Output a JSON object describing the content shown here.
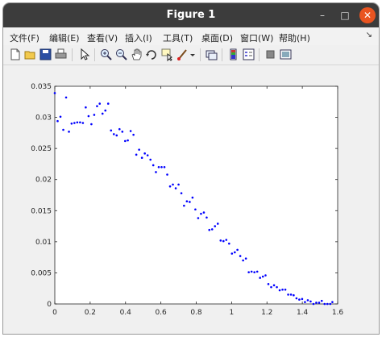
{
  "window": {
    "title": "Figure 1"
  },
  "menu": [
    "文件(F)",
    "编辑(E)",
    "查看(V)",
    "插入(I)",
    "工具(T)",
    "桌面(D)",
    "窗口(W)",
    "帮助(H)"
  ],
  "toolbar_icons": [
    "new-figure-icon",
    "open-file-icon",
    "save-icon",
    "print-icon",
    "pointer-icon",
    "zoom-in-icon",
    "zoom-out-icon",
    "pan-hand-icon",
    "rotate-3d-icon",
    "data-cursor-icon",
    "brush-icon",
    "link-plot-icon",
    "colorbar-icon",
    "legend-icon",
    "hide-plot-tools-icon",
    "show-plot-tools-icon"
  ],
  "chart_data": {
    "type": "scatter",
    "title": "",
    "xlabel": "",
    "ylabel": "",
    "xlim": [
      0,
      1.6
    ],
    "ylim": [
      0,
      0.035
    ],
    "grid": false,
    "marker_color": "#0000ff",
    "x_ticks": [
      "0",
      "0.2",
      "0.4",
      "0.6",
      "0.8",
      "1",
      "1.2",
      "1.4",
      "1.6"
    ],
    "y_ticks": [
      "0",
      "0.005",
      "0.01",
      "0.015",
      "0.02",
      "0.025",
      "0.03",
      "0.035"
    ],
    "series": [
      {
        "x": [
          0.0,
          0.016,
          0.032,
          0.048,
          0.064,
          0.08,
          0.095,
          0.111,
          0.127,
          0.143,
          0.159,
          0.175,
          0.191,
          0.207,
          0.223,
          0.239,
          0.254,
          0.27,
          0.286,
          0.302,
          0.318,
          0.334,
          0.35,
          0.366,
          0.382,
          0.398,
          0.413,
          0.429,
          0.445,
          0.461,
          0.477,
          0.493,
          0.509,
          0.525,
          0.541,
          0.557,
          0.572,
          0.588,
          0.604,
          0.62,
          0.636,
          0.652,
          0.668,
          0.684,
          0.7,
          0.716,
          0.731,
          0.747,
          0.763,
          0.779,
          0.795,
          0.811,
          0.827,
          0.843,
          0.859,
          0.874,
          0.89,
          0.906,
          0.922,
          0.938,
          0.954,
          0.97,
          0.986,
          1.002,
          1.018,
          1.033,
          1.049,
          1.065,
          1.081,
          1.097,
          1.113,
          1.129,
          1.145,
          1.161,
          1.177,
          1.192,
          1.208,
          1.224,
          1.24,
          1.256,
          1.272,
          1.288,
          1.304,
          1.32,
          1.336,
          1.351,
          1.367,
          1.383,
          1.399,
          1.415,
          1.431,
          1.447,
          1.463,
          1.479,
          1.495,
          1.51,
          1.526,
          1.542,
          1.558,
          1.57
        ],
        "y": [
          0.0339,
          0.0294,
          0.0301,
          0.028,
          0.0332,
          0.0277,
          0.029,
          0.0291,
          0.0292,
          0.0292,
          0.0291,
          0.0316,
          0.0302,
          0.0289,
          0.0304,
          0.0318,
          0.0322,
          0.0306,
          0.0311,
          0.0322,
          0.0279,
          0.0273,
          0.0271,
          0.0281,
          0.0277,
          0.0262,
          0.0263,
          0.0278,
          0.0272,
          0.024,
          0.0248,
          0.0235,
          0.0242,
          0.0239,
          0.0232,
          0.0223,
          0.0212,
          0.022,
          0.022,
          0.022,
          0.0208,
          0.0189,
          0.0192,
          0.0186,
          0.0192,
          0.0178,
          0.0158,
          0.0165,
          0.0164,
          0.0171,
          0.0152,
          0.0138,
          0.0145,
          0.0147,
          0.0139,
          0.0119,
          0.012,
          0.0125,
          0.0129,
          0.0102,
          0.0101,
          0.0103,
          0.0097,
          0.0081,
          0.0083,
          0.0087,
          0.0077,
          0.007,
          0.0073,
          0.0051,
          0.0052,
          0.0051,
          0.0052,
          0.0042,
          0.0044,
          0.0046,
          0.0032,
          0.0027,
          0.003,
          0.0027,
          0.0022,
          0.0023,
          0.0023,
          0.0015,
          0.0015,
          0.0014,
          0.0009,
          0.0007,
          0.0008,
          0.0003,
          0.0006,
          0.0004,
          0.0,
          0.0002,
          0.0002,
          0.0005,
          0.0,
          0.0,
          0.0,
          0.0003
        ]
      }
    ]
  }
}
